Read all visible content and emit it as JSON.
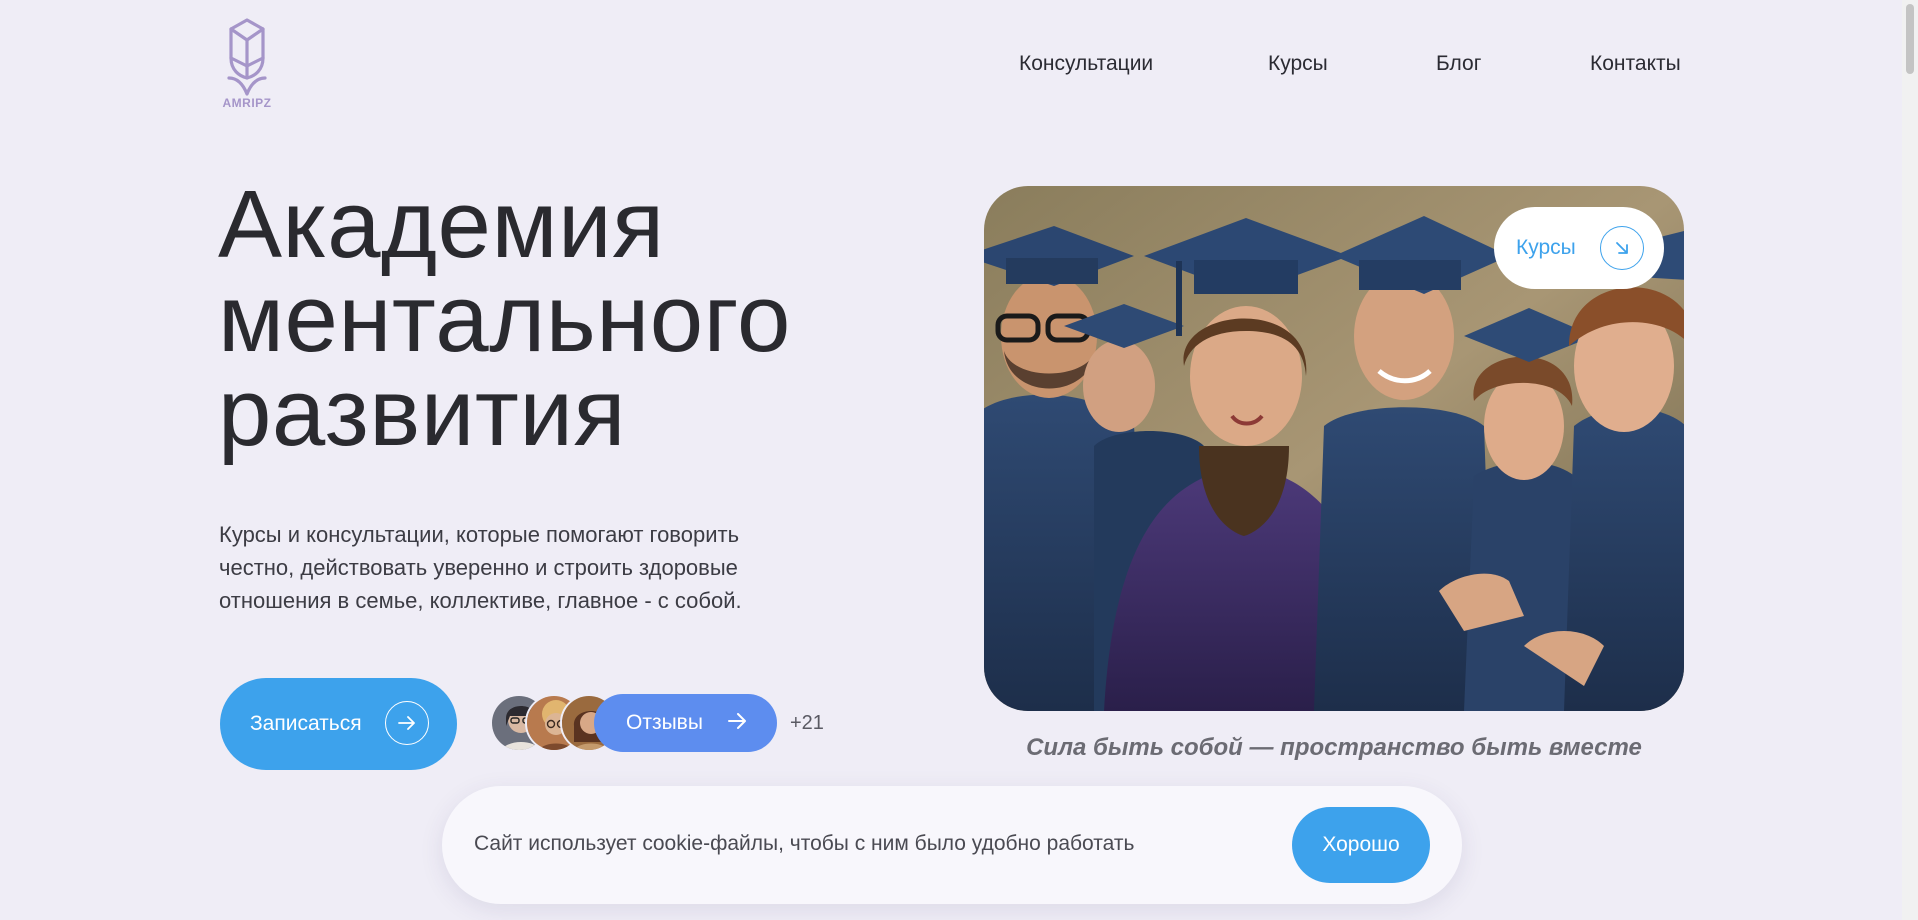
{
  "brand": {
    "name": "AMRIPZ",
    "logo_color": "#a595c9"
  },
  "nav": {
    "items": [
      {
        "label": "Консультации"
      },
      {
        "label": "Курсы"
      },
      {
        "label": "Блог"
      },
      {
        "label": "Контакты"
      }
    ]
  },
  "hero": {
    "title_lines": [
      "Академия",
      "ментального",
      "развития"
    ],
    "subtitle": "Курсы и консультации, которые помогают говорить честно, действовать уверенно и строить здоровые отношения в семье, коллективе, главное - с собой.",
    "signup_label": "Записаться",
    "reviews_label": "Отзывы",
    "reviews_count": "+21",
    "accent": "#3da2ec",
    "reviews_color": "#5d8def"
  },
  "photo": {
    "chip_label": "Курсы",
    "caption": "Сила быть собой — пространство быть вместе"
  },
  "cookie": {
    "text": "Сайт использует cookie-файлы, чтобы с ним было удобно работать",
    "ok_label": "Хорошо"
  },
  "icons": {
    "logo": "tulip-logo-icon",
    "signup": "arrow-right-icon",
    "reviews": "arrow-right-icon",
    "chip": "arrow-down-right-icon"
  }
}
